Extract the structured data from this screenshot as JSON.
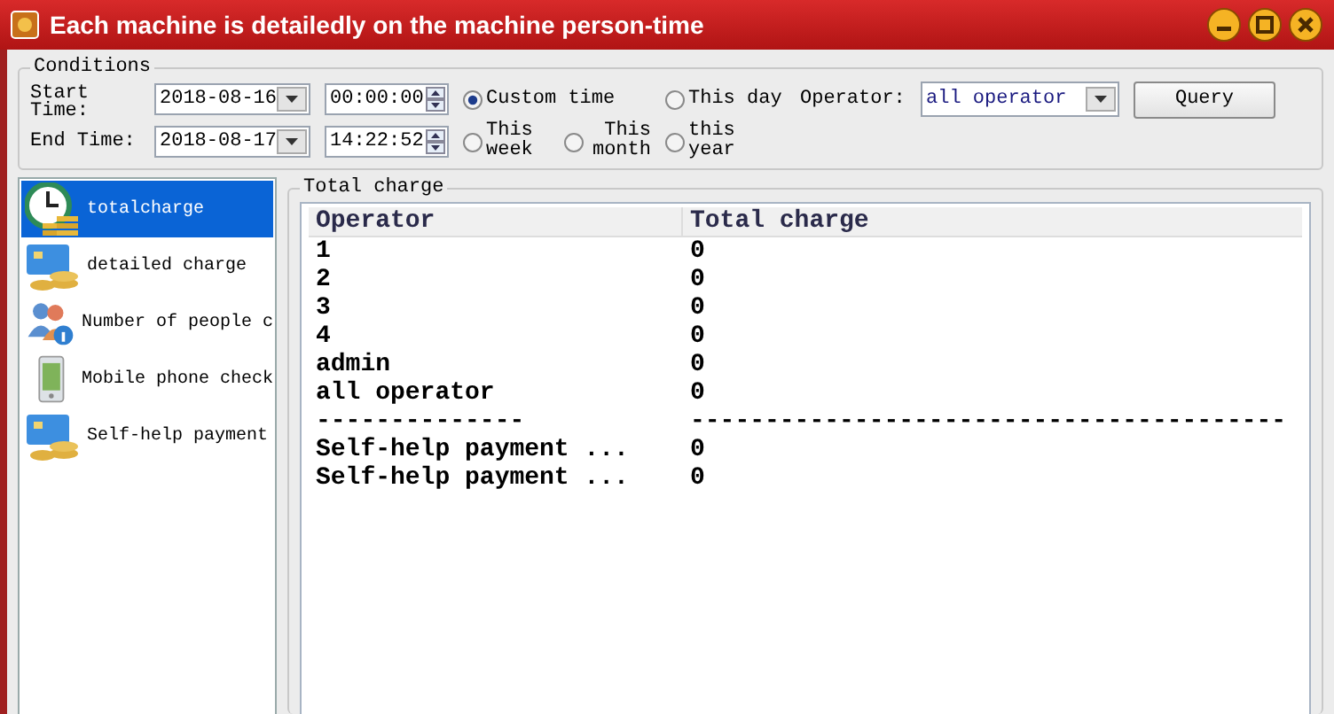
{
  "window": {
    "title": "Each machine is detailedly on the machine person-time"
  },
  "conditions": {
    "title": "Conditions",
    "start_label": "Start Time:",
    "start_date": "2018-08-16",
    "start_time": "00:00:00",
    "end_label": "End Time:",
    "end_date": "2018-08-17",
    "end_time": "14:22:52",
    "ranges": [
      {
        "label": "Custom time",
        "selected": true
      },
      {
        "label": "This day",
        "selected": false
      },
      {
        "label": "This week",
        "selected": false
      },
      {
        "label": "This month",
        "selected": false
      },
      {
        "label": "this year",
        "selected": false
      }
    ],
    "operator_label": "Operator:",
    "operator_value": "all operator",
    "query_button": "Query"
  },
  "sidebar": {
    "items": [
      {
        "label": "totalcharge",
        "kind": "clock",
        "selected": true
      },
      {
        "label": "detailed charge",
        "kind": "card",
        "selected": false
      },
      {
        "label": "Number of people c",
        "kind": "people",
        "selected": false
      },
      {
        "label": "Mobile phone check",
        "kind": "phone",
        "selected": false
      },
      {
        "label": "Self-help payment",
        "kind": "card",
        "selected": false
      }
    ]
  },
  "report": {
    "title": "Total charge",
    "columns": [
      "Operator",
      "Total charge"
    ],
    "rows": [
      [
        "1",
        "0"
      ],
      [
        "2",
        "0"
      ],
      [
        "3",
        "0"
      ],
      [
        "4",
        "0"
      ],
      [
        "admin",
        "0"
      ],
      [
        "all operator",
        "0"
      ],
      [
        "--------------",
        "----------------------------------------"
      ],
      [
        "Self-help payment ...",
        "0"
      ],
      [
        "Self-help payment ...",
        "0"
      ]
    ]
  }
}
